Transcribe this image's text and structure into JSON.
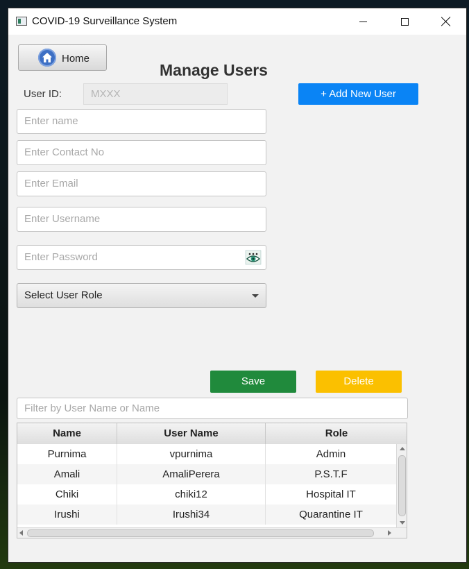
{
  "window": {
    "title": "COVID-19 Surveillance System"
  },
  "nav": {
    "home_label": "Home"
  },
  "page": {
    "title": "Manage Users"
  },
  "form": {
    "user_id_label": "User ID:",
    "user_id_placeholder": "MXXX",
    "name_placeholder": "Enter  name",
    "contact_placeholder": "Enter Contact No",
    "email_placeholder": "Enter Email",
    "username_placeholder": "Enter Username",
    "password_placeholder": "Enter Password",
    "role_select_value": "Select User Role"
  },
  "actions": {
    "add_new_user_label": "+ Add New User",
    "save_label": "Save",
    "delete_label": "Delete"
  },
  "filter": {
    "placeholder": "Filter by User Name or Name"
  },
  "table": {
    "columns": [
      "Name",
      "User Name",
      "Role"
    ],
    "rows": [
      [
        "Purnima",
        "vpurnima",
        "Admin"
      ],
      [
        "Amali",
        "AmaliPerera",
        "P.S.T.F"
      ],
      [
        "Chiki",
        "chiki12",
        "Hospital IT"
      ],
      [
        "Irushi",
        "Irushi34",
        "Quarantine IT"
      ]
    ]
  },
  "colors": {
    "add_button": "#0a84f5",
    "save_button": "#208a3c",
    "delete_button": "#fbc000"
  },
  "icons": {
    "app": "app-window-icon",
    "home": "home-icon",
    "password_toggle": "eye-icon",
    "dropdown": "chevron-down-icon"
  }
}
